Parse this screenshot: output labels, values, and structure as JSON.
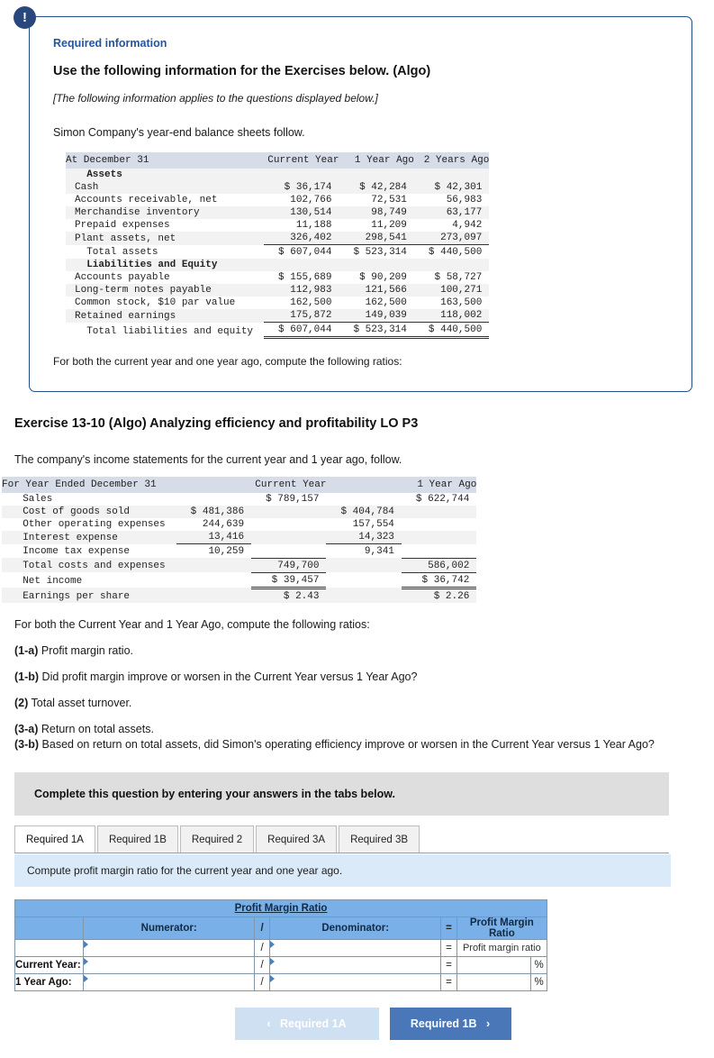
{
  "required_info": {
    "badge_icon": "exclamation-icon",
    "title": "Required information",
    "subtitle": "Use the following information for the Exercises below. (Algo)",
    "italic_note": "[The following information applies to the questions displayed below.]",
    "lead": "Simon Company's year-end balance sheets follow.",
    "footer": "For both the current year and one year ago, compute the following ratios:"
  },
  "balance_sheet": {
    "headers": [
      "At December 31",
      "Current Year",
      "1 Year Ago",
      "2 Years Ago"
    ],
    "rows": [
      {
        "label": "Assets",
        "type": "section",
        "values": [
          "",
          "",
          ""
        ]
      },
      {
        "label": "Cash",
        "type": "data",
        "values": [
          "$ 36,174",
          "$ 42,284",
          "$ 42,301"
        ]
      },
      {
        "label": "Accounts receivable, net",
        "type": "data",
        "values": [
          "102,766",
          "72,531",
          "56,983"
        ]
      },
      {
        "label": "Merchandise inventory",
        "type": "data",
        "values": [
          "130,514",
          "98,749",
          "63,177"
        ]
      },
      {
        "label": "Prepaid expenses",
        "type": "data",
        "values": [
          "11,188",
          "11,209",
          "4,942"
        ]
      },
      {
        "label": "Plant assets, net",
        "type": "data",
        "values": [
          "326,402",
          "298,541",
          "273,097"
        ]
      },
      {
        "label": "Total assets",
        "type": "total",
        "values": [
          "$ 607,044",
          "$ 523,314",
          "$ 440,500"
        ]
      },
      {
        "label": "Liabilities and Equity",
        "type": "section",
        "values": [
          "",
          "",
          ""
        ]
      },
      {
        "label": "Accounts payable",
        "type": "data",
        "values": [
          "$ 155,689",
          "$ 90,209",
          "$ 58,727"
        ]
      },
      {
        "label": "Long-term notes payable",
        "type": "data",
        "values": [
          "112,983",
          "121,566",
          "100,271"
        ]
      },
      {
        "label": "Common stock, $10 par value",
        "type": "data",
        "values": [
          "162,500",
          "162,500",
          "163,500"
        ]
      },
      {
        "label": "Retained earnings",
        "type": "data",
        "values": [
          "175,872",
          "149,039",
          "118,002"
        ]
      },
      {
        "label": "Total liabilities and equity",
        "type": "grandtotal",
        "values": [
          "$ 607,044",
          "$ 523,314",
          "$ 440,500"
        ]
      }
    ]
  },
  "exercise": {
    "title": "Exercise 13-10 (Algo) Analyzing efficiency and profitability LO P3",
    "lead": "The company's income statements for the current year and 1 year ago, follow."
  },
  "income_statement": {
    "headers": [
      "For Year Ended December 31",
      "Current Year",
      "1 Year Ago"
    ],
    "rows": [
      {
        "label": "Sales",
        "cy_sub": "",
        "cy_tot": "$ 789,157",
        "py_sub": "",
        "py_tot": "$ 622,744"
      },
      {
        "label": "Cost of goods sold",
        "cy_sub": "$ 481,386",
        "cy_tot": "",
        "py_sub": "$ 404,784",
        "py_tot": ""
      },
      {
        "label": "Other operating expenses",
        "cy_sub": "244,639",
        "cy_tot": "",
        "py_sub": "157,554",
        "py_tot": ""
      },
      {
        "label": "Interest expense",
        "cy_sub": "13,416",
        "cy_tot": "",
        "py_sub": "14,323",
        "py_tot": ""
      },
      {
        "label": "Income tax expense",
        "cy_sub": "10,259",
        "cy_tot": "",
        "py_sub": "9,341",
        "py_tot": ""
      },
      {
        "label": "Total costs and expenses",
        "cy_sub": "",
        "cy_tot": "749,700",
        "py_sub": "",
        "py_tot": "586,002"
      },
      {
        "label": "Net income",
        "cy_sub": "",
        "cy_tot": "$ 39,457",
        "py_sub": "",
        "py_tot": "$ 36,742"
      },
      {
        "label": "Earnings per share",
        "cy_sub": "",
        "cy_tot": "$ 2.43",
        "py_sub": "",
        "py_tot": "$ 2.26"
      }
    ]
  },
  "questions": {
    "intro": "For both the Current Year and 1 Year Ago, compute the following ratios:",
    "items": [
      {
        "num": "(1-a)",
        "text": " Profit margin ratio."
      },
      {
        "num": "(1-b)",
        "text": " Did profit margin improve or worsen in the Current Year versus 1 Year Ago?"
      },
      {
        "num": "(2)",
        "text": " Total asset turnover."
      },
      {
        "num": "(3-a)",
        "text": " Return on total assets."
      },
      {
        "num": "(3-b)",
        "text": " Based on return on total assets, did Simon's operating efficiency improve or worsen in the Current Year versus 1 Year Ago?"
      }
    ]
  },
  "answer_area": {
    "complete_banner": "Complete this question by entering your answers in the tabs below.",
    "tabs": [
      {
        "label": "Required 1A",
        "active": true
      },
      {
        "label": "Required 1B",
        "active": false
      },
      {
        "label": "Required 2",
        "active": false
      },
      {
        "label": "Required 3A",
        "active": false
      },
      {
        "label": "Required 3B",
        "active": false
      }
    ],
    "instruction": "Compute profit margin ratio for the current year and one year ago.",
    "table": {
      "title": "Profit Margin Ratio",
      "col_numerator": "Numerator:",
      "col_slash": "/",
      "col_denominator": "Denominator:",
      "col_equals": "=",
      "col_result": "Profit Margin Ratio",
      "result_hint": "Profit margin ratio",
      "pct_symbol": "%",
      "rows": [
        {
          "label": "",
          "numerator": "",
          "denominator": "",
          "result": "Profit margin ratio",
          "is_hint": true
        },
        {
          "label": "Current Year:",
          "numerator": "",
          "denominator": "",
          "result": "",
          "is_hint": false
        },
        {
          "label": "1 Year Ago:",
          "numerator": "",
          "denominator": "",
          "result": "",
          "is_hint": false
        }
      ]
    },
    "nav": {
      "prev_label": "Required 1A",
      "prev_chevron": "‹",
      "next_label": "Required 1B",
      "next_chevron": "›"
    }
  },
  "colors": {
    "accent_blue": "#2255a4",
    "badge_blue": "#27477d",
    "table_header_blue": "#79b0e8",
    "instruction_blue": "#daeaf8",
    "banner_gray": "#dedede",
    "button_blue": "#4a77b8"
  }
}
